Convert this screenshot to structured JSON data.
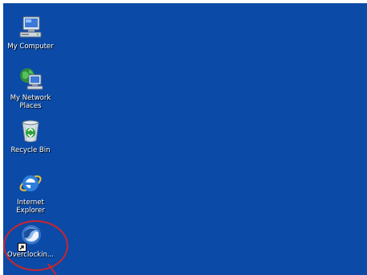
{
  "desktop": {
    "background_color": "#0b4aa6",
    "icons": [
      {
        "label": "My Computer",
        "icon": "my-computer-icon"
      },
      {
        "label": "My Network Places",
        "icon": "network-places-icon"
      },
      {
        "label": "Recycle Bin",
        "icon": "recycle-bin-icon"
      },
      {
        "label": "Internet Explorer",
        "icon": "internet-explorer-icon"
      },
      {
        "label": "Overclockin...",
        "icon": "overclocking-app-icon"
      }
    ]
  },
  "annotation": {
    "color": "#c9262e"
  }
}
